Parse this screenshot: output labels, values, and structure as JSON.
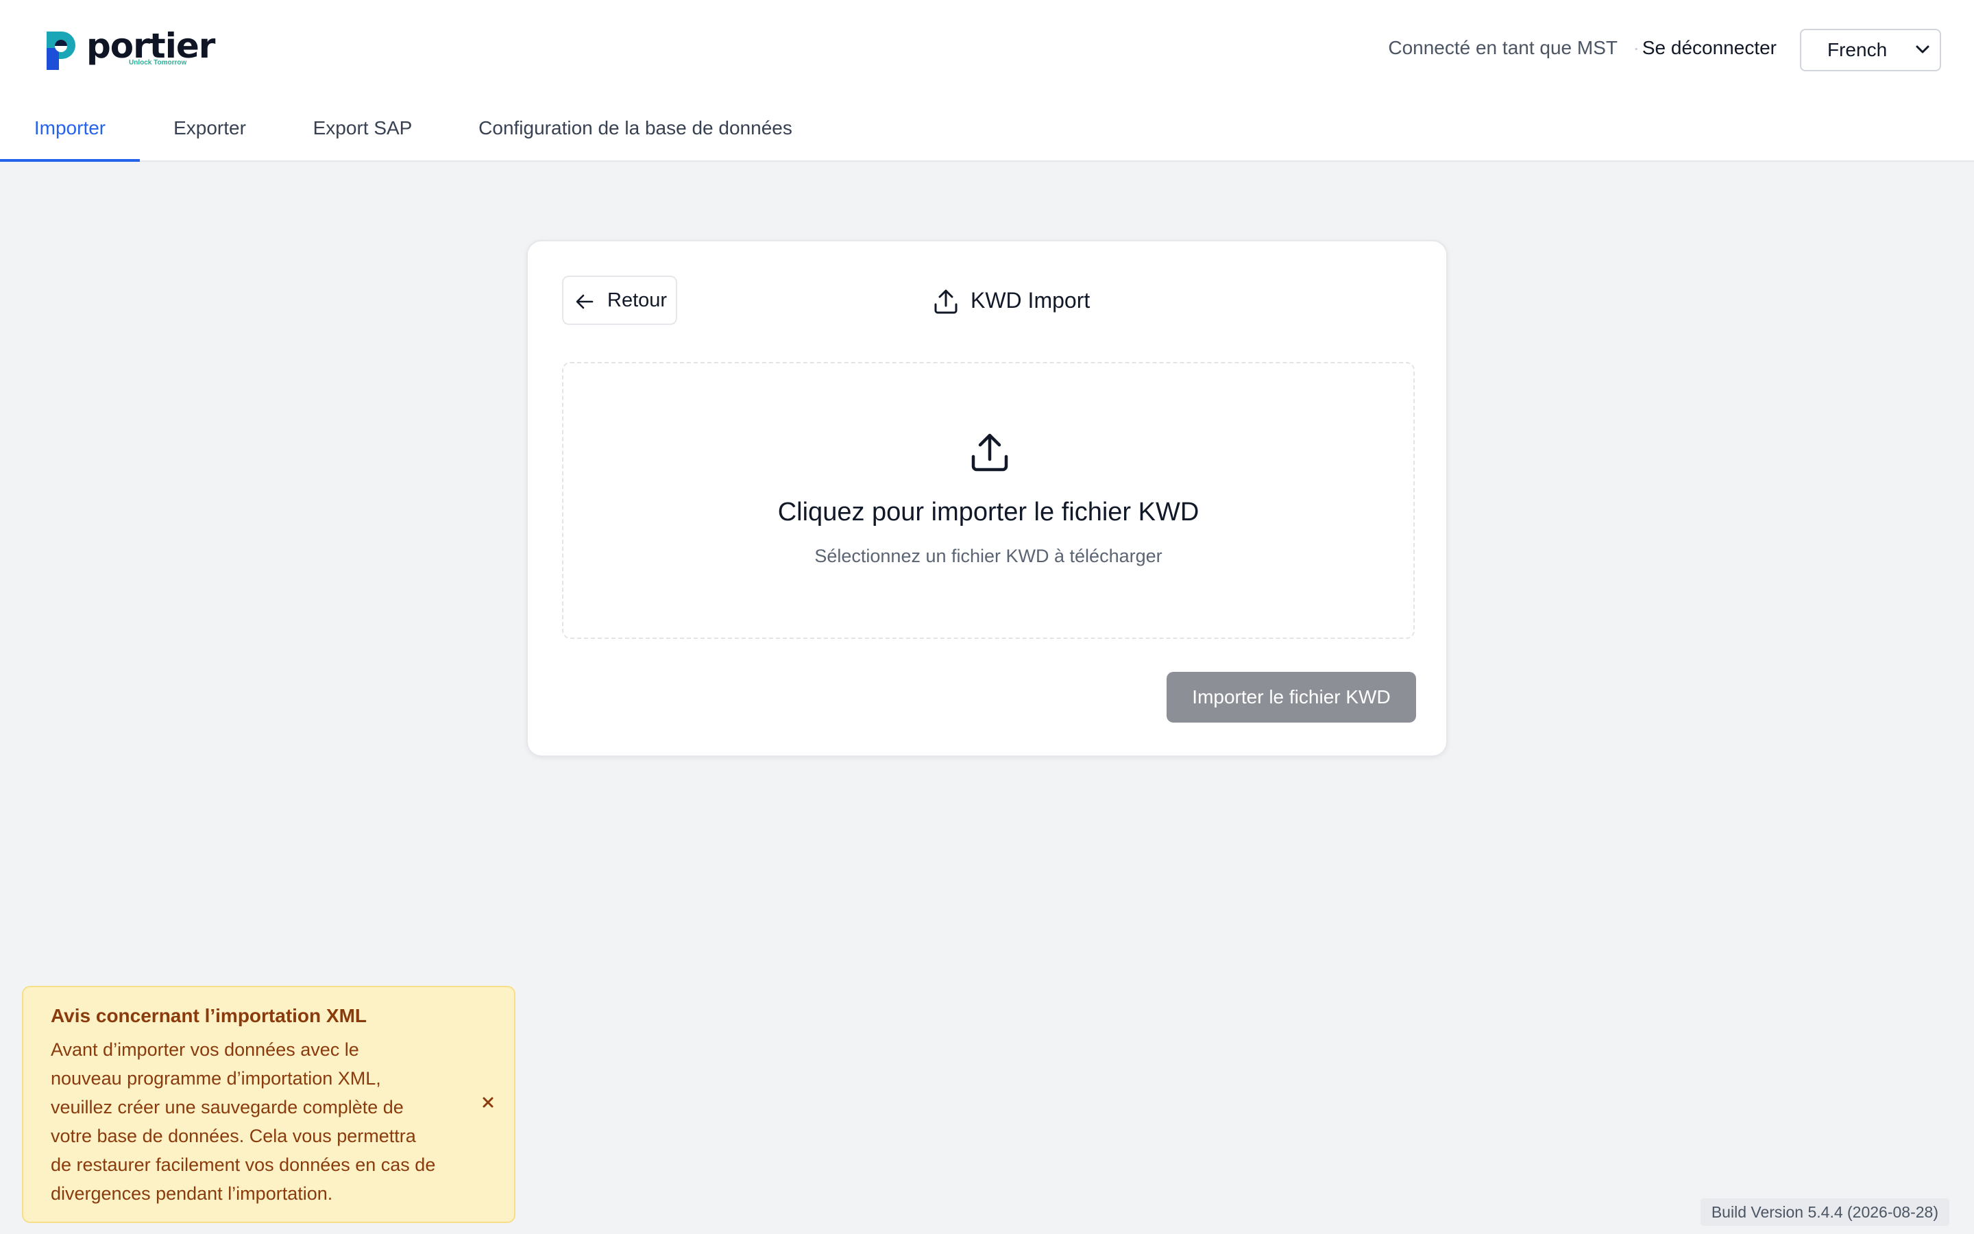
{
  "header": {
    "logo_text": "portier",
    "logo_tagline": "Unlock Tomorrow",
    "connected_as": "Connecté en tant que MST",
    "separator": "·",
    "logout_label": "Se déconnecter",
    "language_selected": "French"
  },
  "tabs": [
    {
      "label": "Importer",
      "active": true
    },
    {
      "label": "Exporter",
      "active": false
    },
    {
      "label": "Export SAP",
      "active": false
    },
    {
      "label": "Configuration de la base de données",
      "active": false
    }
  ],
  "card": {
    "back_label": "Retour",
    "title": "KWD Import",
    "dropzone_title": "Cliquez pour importer le fichier KWD",
    "dropzone_subtitle": "Sélectionnez un fichier KWD à télécharger",
    "import_button_label": "Importer le fichier KWD"
  },
  "notice": {
    "title": "Avis concernant l’importation XML",
    "body_lines": [
      "Avant d’importer vos données avec le",
      "nouveau programme d’importation XML,",
      "veuillez créer une sauvegarde complète de",
      "votre base de données. Cela vous permettra",
      "de restaurer facilement vos données en cas de",
      "divergences pendant l’importation."
    ]
  },
  "build_version": "Build Version 5.4.4 (2026-08-28)",
  "colors": {
    "accent": "#2563eb",
    "notice_bg": "#fdf2c6",
    "notice_text": "#8a3b0d",
    "disabled_button": "#8c8f96"
  },
  "icons": {
    "back": "arrow-left-icon",
    "title": "upload-icon",
    "dropzone": "upload-icon",
    "close": "close-icon",
    "language": "chevron-down-icon"
  }
}
